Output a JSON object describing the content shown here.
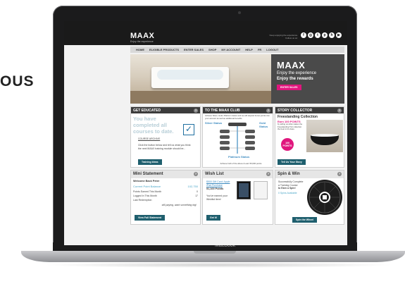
{
  "side_text": "OUS",
  "laptop_brand": "MacBook",
  "site": {
    "logo": "MAAX",
    "logo_sub": "Enjoy the experience",
    "follow_text": "Keep enjoying the experience. Follow us on:",
    "social_icons": [
      "facebook-icon",
      "instagram-icon",
      "twitter-icon",
      "pinterest-icon",
      "houzz-icon",
      "youtube-icon"
    ]
  },
  "nav": [
    "HOME",
    "ELIGIBLE PRODUCTS",
    "ENTER SALES",
    "SHOP",
    "MY ACCOUNT",
    "HELP",
    "FR",
    "LOGOUT"
  ],
  "hero": {
    "title": "MAAX",
    "line1": "Enjoy the experience",
    "line2": "Enjoy the rewards",
    "button": "ENTER SALES",
    "accent": "#e0167d"
  },
  "panels": {
    "educated": {
      "title": "GET EDUCATED",
      "headline": "You have completed all courses to date.",
      "link": "COURSE ARCHIVE",
      "body": "Click the button below and tell us what you think the next MAAX training module should be...",
      "button": "Training Ideas"
    },
    "club": {
      "title": "TO THE MAAX CLUB",
      "intro": "Achieve Silver, Gold, Platinum status and we will deposit bonus points into your account as well as additional benefits.",
      "silver": "Silver Status",
      "gold": "Gold Status",
      "platinum": "Platinum Status",
      "footer": "Achieve both of the above & earn 50,000 points"
    },
    "story": {
      "title": "STORY COLLECTOR",
      "heading": "Freestanding Collection",
      "earn": "Earn 100 POINTS",
      "body": "by telling us what makes the Freestanding Tub collection the best in its class.",
      "badge": "100 POINTS",
      "button": "Tell Us Your Story"
    },
    "statement": {
      "title": "Mini Statement",
      "welcome": "Welcome Back Peter",
      "balance_label": "Current Point Balance",
      "balance_value": "102,750",
      "rows": [
        {
          "label": "Points Earned This Month",
          "value": "0"
        },
        {
          "label": "Logged In This Month",
          "value": "17"
        },
        {
          "label": "Last Redemption",
          "value": ""
        }
      ],
      "note": "still paying, want something big!",
      "button": "View Full Statement"
    },
    "wishlist": {
      "title": "Wish List",
      "item": "$500 Gift Card: Apple iPad Purchase",
      "points": "51,100 Points",
      "note": "You've earned your Wishlist item!",
      "button": "Get It!"
    },
    "spin": {
      "title": "Spin & Win",
      "line1": "Successfully Complete",
      "line2": "a Training Course",
      "line3": "to Earn a Spin!",
      "available": "0 Spins Available",
      "button": "Spin the Wheel"
    }
  }
}
